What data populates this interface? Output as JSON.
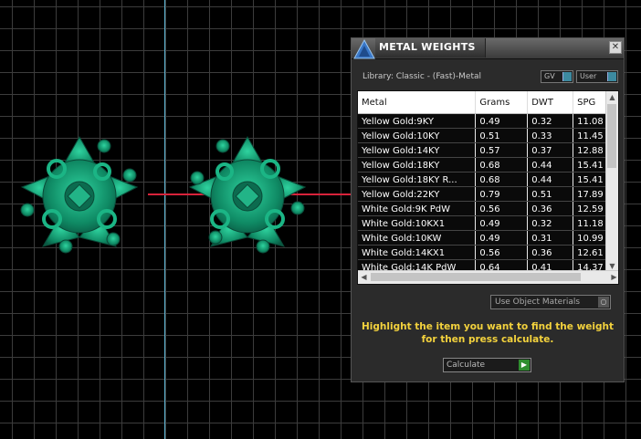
{
  "panel": {
    "title": "METAL WEIGHTS",
    "close_symbol": "✕",
    "library_label": "Library: Classic - (Fast)-Metal",
    "toggle_gv": "GV",
    "toggle_user": "User",
    "table": {
      "columns": [
        "Metal",
        "Grams",
        "DWT",
        "SPG"
      ],
      "rows": [
        [
          "Yellow Gold:9KY",
          "0.49",
          "0.32",
          "11.08"
        ],
        [
          "Yellow Gold:10KY",
          "0.51",
          "0.33",
          "11.45"
        ],
        [
          "Yellow Gold:14KY",
          "0.57",
          "0.37",
          "12.88"
        ],
        [
          "Yellow Gold:18KY",
          "0.68",
          "0.44",
          "15.41"
        ],
        [
          "Yellow Gold:18KY R...",
          "0.68",
          "0.44",
          "15.41"
        ],
        [
          "Yellow Gold:22KY",
          "0.79",
          "0.51",
          "17.89"
        ],
        [
          "White Gold:9K PdW",
          "0.56",
          "0.36",
          "12.59"
        ],
        [
          "White Gold:10KX1",
          "0.49",
          "0.32",
          "11.18"
        ],
        [
          "White Gold:10KW",
          "0.49",
          "0.31",
          "10.99"
        ],
        [
          "White Gold:14KX1",
          "0.56",
          "0.36",
          "12.61"
        ],
        [
          "White Gold:14K PdW",
          "0.64",
          "0.41",
          "14.37"
        ]
      ]
    },
    "materials_dropdown": "Use Object Materials",
    "instruction": "Highlight the item you want to find the weight for then press calculate.",
    "calculate_label": "Calculate"
  },
  "colors": {
    "accent_text": "#f3d23d",
    "jewel_green": "#14a37a",
    "axis_x": "#d8233b",
    "axis_y": "#5fb7d6"
  },
  "icons": {
    "logo": "triangle-logo-icon",
    "close": "close-icon",
    "go": "play-arrow-icon"
  }
}
